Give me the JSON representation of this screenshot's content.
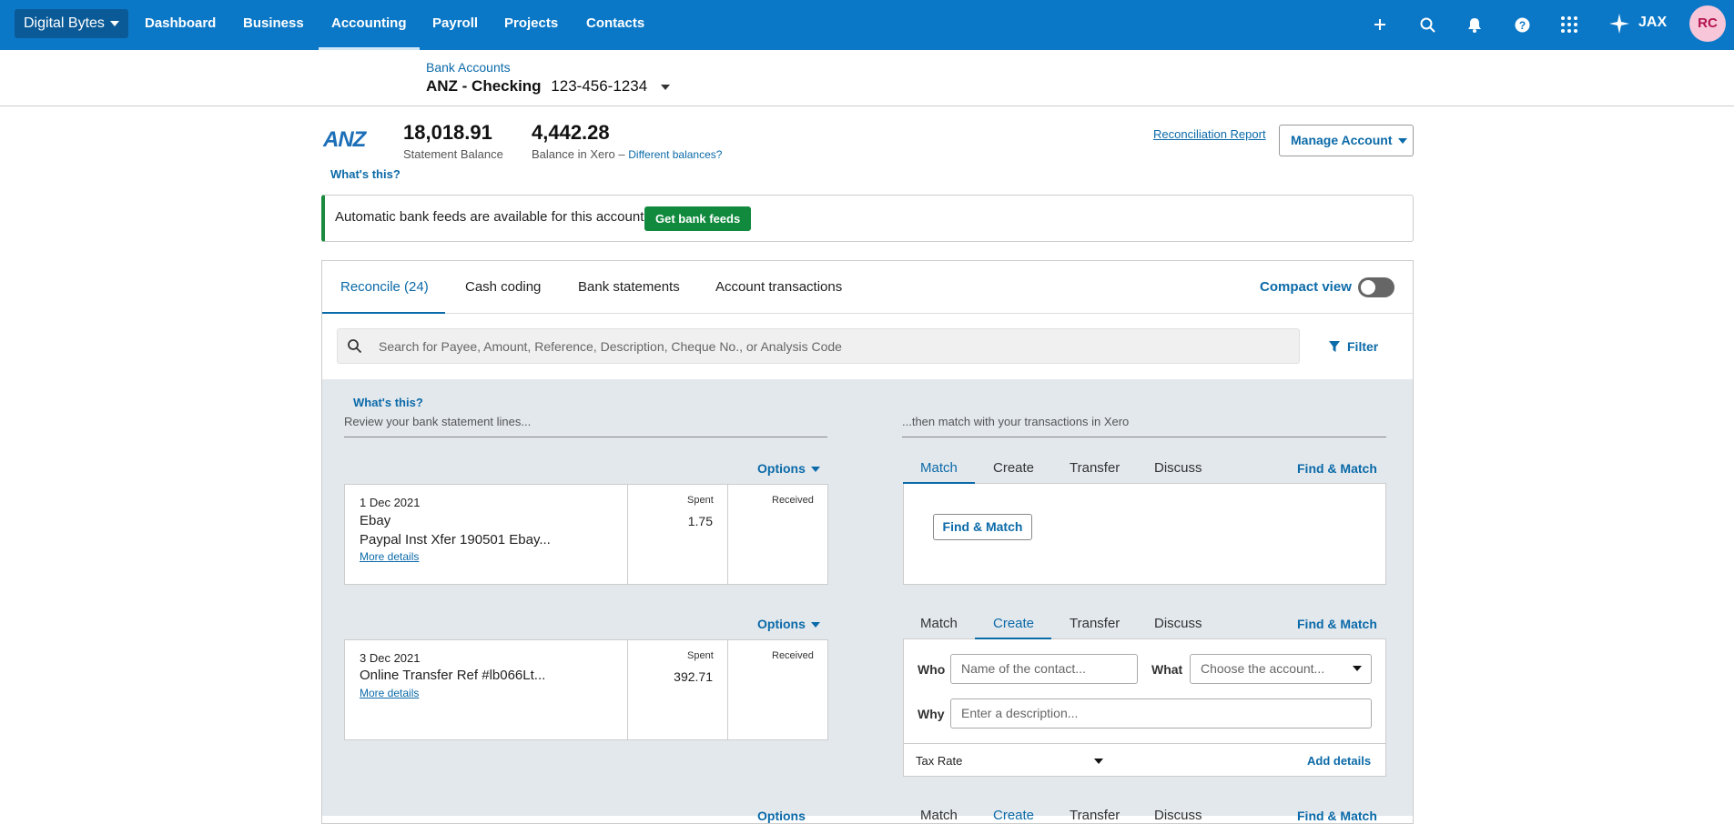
{
  "topbar": {
    "org": "Digital Bytes",
    "nav": [
      "Dashboard",
      "Business",
      "Accounting",
      "Payroll",
      "Projects",
      "Contacts"
    ],
    "active_nav": "Accounting",
    "jax": "JAX",
    "avatar": "RC",
    "icons": [
      "plus-icon",
      "search-icon",
      "bell-icon",
      "help-icon",
      "apps-grid-icon",
      "sparkle-icon"
    ]
  },
  "subheader": {
    "breadcrumb": "Bank Accounts",
    "account_name": "ANZ - Checking",
    "account_number": "123-456-1234"
  },
  "balances": {
    "bank_logo": "ANZ",
    "statement_balance": "18,018.91",
    "statement_label": "Statement Balance",
    "xero_balance": "4,442.28",
    "xero_label": "Balance in Xero",
    "separator": "–",
    "different_link": "Different balances?",
    "whats_this": "What's this?",
    "reconciliation_report": "Reconciliation Report",
    "manage_account": "Manage Account"
  },
  "feed_banner": {
    "text": "Automatic bank feeds are available for this account",
    "button": "Get bank feeds",
    "accent": "#1b8a3e"
  },
  "tabs": {
    "items": [
      "Reconcile (24)",
      "Cash coding",
      "Bank statements",
      "Account transactions"
    ],
    "active": "Reconcile (24)",
    "compact_view": "Compact view",
    "compact_on": false
  },
  "search": {
    "placeholder": "Search for Payee, Amount, Reference, Description, Cheque No., or Analysis Code",
    "filter": "Filter"
  },
  "reconcile": {
    "whats_this": "What's this?",
    "left_header": "Review your bank statement lines...",
    "right_header": "...then match with your transactions in Xero",
    "options_label": "Options",
    "spent_label": "Spent",
    "received_label": "Received",
    "more_details": "More details",
    "right_tabs": [
      "Match",
      "Create",
      "Transfer",
      "Discuss"
    ],
    "find_match": "Find & Match",
    "lines": [
      {
        "date": "1 Dec 2021",
        "payee": "Ebay",
        "description": "Paypal Inst Xfer 190501 Ebay...",
        "spent": "1.75",
        "received": "",
        "active_tab": "Match"
      },
      {
        "date": "3 Dec 2021",
        "payee": "",
        "description": "Online Transfer Ref #lb066Lt...",
        "spent": "392.71",
        "received": "",
        "active_tab": "Create"
      }
    ],
    "create_form": {
      "who_label": "Who",
      "who_placeholder": "Name of the contact...",
      "what_label": "What",
      "what_placeholder": "Choose the account...",
      "why_label": "Why",
      "why_placeholder": "Enter a description...",
      "tax_rate": "Tax Rate",
      "add_details": "Add details"
    },
    "third_row_tabs": [
      "Options",
      "Match",
      "Create",
      "Transfer",
      "Discuss",
      "Find & Match"
    ]
  },
  "colors": {
    "topbar": "#0b78c7",
    "link": "#0b6aa8",
    "panel_bg": "#e3e8ed"
  }
}
